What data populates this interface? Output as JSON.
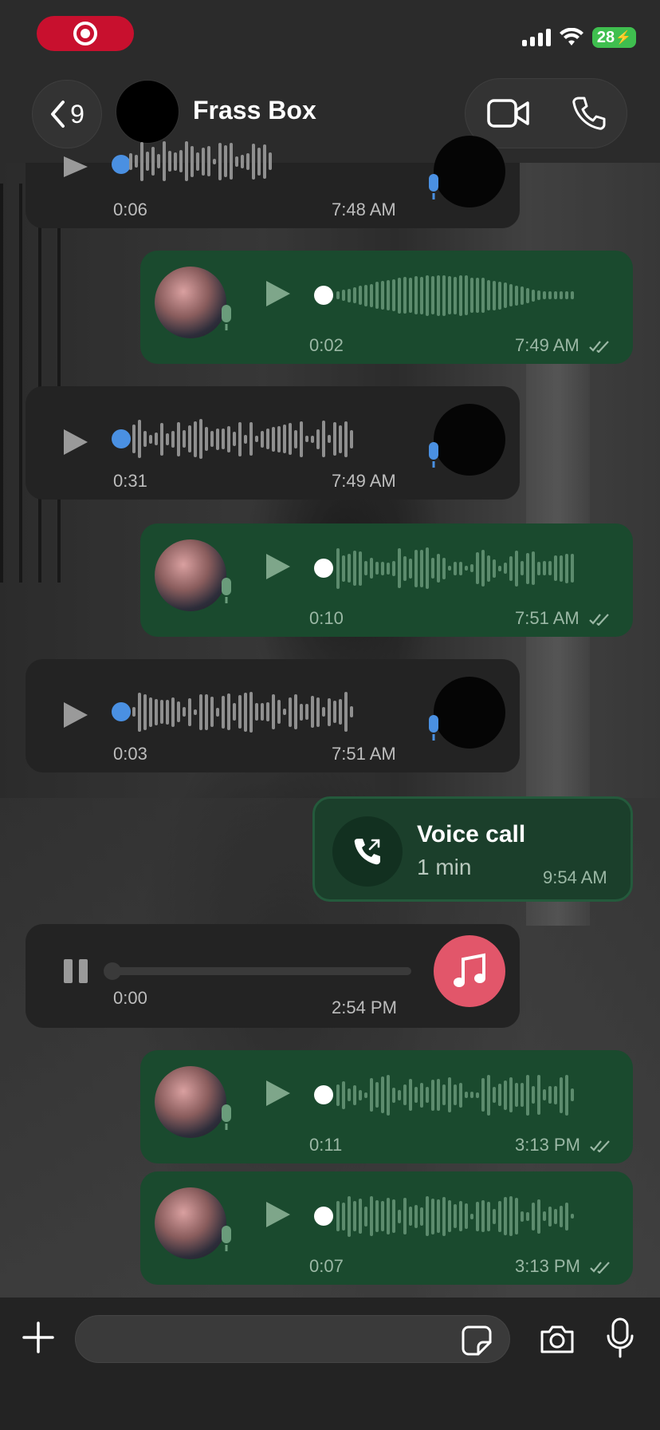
{
  "status_bar": {
    "battery": "28",
    "recording": true
  },
  "header": {
    "back_count": "9",
    "contact_name": "Frass Box"
  },
  "messages": [
    {
      "kind": "voice",
      "direction": "in",
      "duration": "0:06",
      "time": "7:48 AM"
    },
    {
      "kind": "voice",
      "direction": "out",
      "duration": "0:02",
      "time": "7:49 AM",
      "read": true
    },
    {
      "kind": "voice",
      "direction": "in",
      "duration": "0:31",
      "time": "7:49 AM"
    },
    {
      "kind": "voice",
      "direction": "out",
      "duration": "0:10",
      "time": "7:51 AM",
      "read": true
    },
    {
      "kind": "voice",
      "direction": "in",
      "duration": "0:03",
      "time": "7:51 AM"
    },
    {
      "kind": "call",
      "direction": "out",
      "title": "Voice call",
      "subtitle": "1 min",
      "time": "9:54 AM"
    },
    {
      "kind": "audio",
      "direction": "in",
      "duration": "0:00",
      "time": "2:54 PM",
      "progress": 0
    },
    {
      "kind": "voice",
      "direction": "out",
      "duration": "0:11",
      "time": "3:13 PM",
      "read": true
    },
    {
      "kind": "voice",
      "direction": "out",
      "duration": "0:07",
      "time": "3:13 PM",
      "read": true
    }
  ],
  "input": {
    "placeholder": "",
    "value": ""
  },
  "colors": {
    "incoming_bubble": "#232323",
    "outgoing_bubble": "#1a4a2e",
    "accent_blue": "#4a90e2",
    "recording_red": "#c8102e",
    "music_pink": "#e2566a"
  },
  "icons": {
    "back": "chevron-left-icon",
    "video": "video-camera-icon",
    "phone": "phone-icon",
    "add": "plus-icon",
    "sticker": "sticker-icon",
    "camera": "camera-icon",
    "mic": "microphone-icon",
    "music": "music-note-icon"
  }
}
